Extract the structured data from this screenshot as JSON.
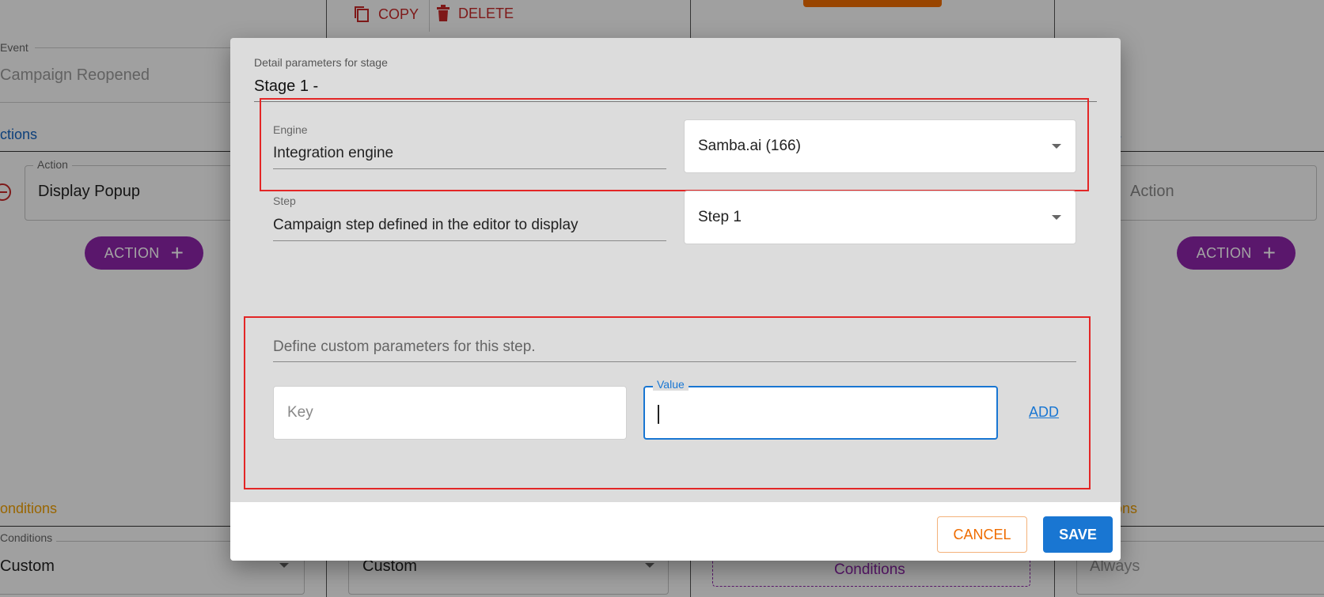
{
  "background": {
    "toolbar": {
      "copy_label": "COPY",
      "delete_label": "DELETE"
    },
    "event": {
      "label": "Event",
      "value": "Campaign Reopened"
    },
    "actions_heading_left": "ctions",
    "actions_heading_right": "s",
    "action_field": {
      "label": "Action",
      "value": "Display Popup"
    },
    "action_field_right_placeholder": "Action",
    "action_button_label": "ACTION",
    "conditions_heading_left": "onditions",
    "conditions_heading_right": "ions",
    "conditions_field": {
      "label": "Conditions",
      "value": "Custom"
    },
    "conditions_select_2": "Custom",
    "conditions_button_label": "Conditions",
    "conditions_right_value": "Always"
  },
  "modal": {
    "header_caption": "Detail parameters for stage",
    "stage_title": "Stage 1 -",
    "engine": {
      "label": "Engine",
      "description": "Integration engine",
      "selected": "Samba.ai (166)"
    },
    "step": {
      "label": "Step",
      "description": "Campaign step defined in the editor to display",
      "selected": "Step 1"
    },
    "custom_params": {
      "prompt": "Define custom parameters for this step.",
      "key_placeholder": "Key",
      "value_label": "Value",
      "value": "",
      "add_label": "ADD"
    },
    "cancel_label": "CANCEL",
    "save_label": "SAVE"
  },
  "colors": {
    "primary": "#1976d2",
    "purple": "#8e24aa",
    "orange": "#ef6c00",
    "danger_red": "#b71c1c",
    "highlight_red": "#e32626",
    "link_blue": "#1565c0"
  }
}
